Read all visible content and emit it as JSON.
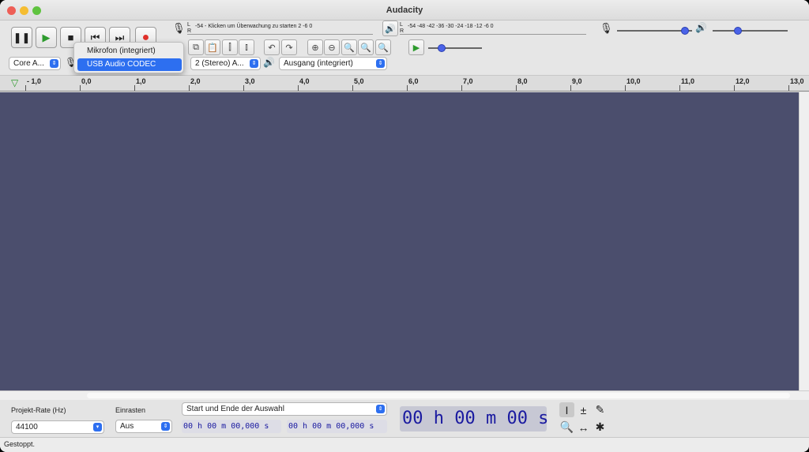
{
  "window": {
    "title": "Audacity"
  },
  "transport": {
    "pause_icon": "pause-icon",
    "play_icon": "play-icon",
    "stop_icon": "stop-icon",
    "skip_start_icon": "skip-to-start-icon",
    "skip_end_icon": "skip-to-end-icon",
    "record_icon": "record-icon",
    "record_color": "#e0302a",
    "play_color": "#2e9b2e"
  },
  "recording_meter": {
    "channels": "L\nR",
    "scale": "-54  -  Klicken um Überwachung zu starten  2   -6   0"
  },
  "playback_meter": {
    "channels": "L\nR",
    "scale": "-54   -48   -42   -36   -30   -24   -18   -12   -6   0"
  },
  "mixer": {
    "recording_level": 0.95,
    "playback_level": 0.32
  },
  "play_at_speed": {
    "speed": 0.2
  },
  "device_toolbar": {
    "host": "Core A...",
    "channels": "2 (Stereo) A...",
    "output_device": "Ausgang (integriert)"
  },
  "input_dropdown": {
    "items": [
      {
        "label": "Mikrofon (integriert)",
        "selected": false
      },
      {
        "label": "USB Audio CODEC",
        "selected": true
      }
    ]
  },
  "ruler": {
    "ticks": [
      "- 1,0",
      "0,0",
      "1,0",
      "2,0",
      "3,0",
      "4,0",
      "5,0",
      "6,0",
      "7,0",
      "8,0",
      "9,0",
      "10,0",
      "11,0",
      "12,0",
      "13,0"
    ]
  },
  "selection_toolbar": {
    "rate_label": "Projekt-Rate (Hz)",
    "rate_value": "44100",
    "snap_label": "Einrasten",
    "snap_value": "Aus",
    "selection_mode": "Start und Ende der Auswahl",
    "start_time": "00 h 00 m 00,000 s",
    "end_time": "00 h 00 m 00,000 s",
    "audio_position": "00 h 00 m 00 s"
  },
  "status": {
    "text": "Gestoppt."
  }
}
